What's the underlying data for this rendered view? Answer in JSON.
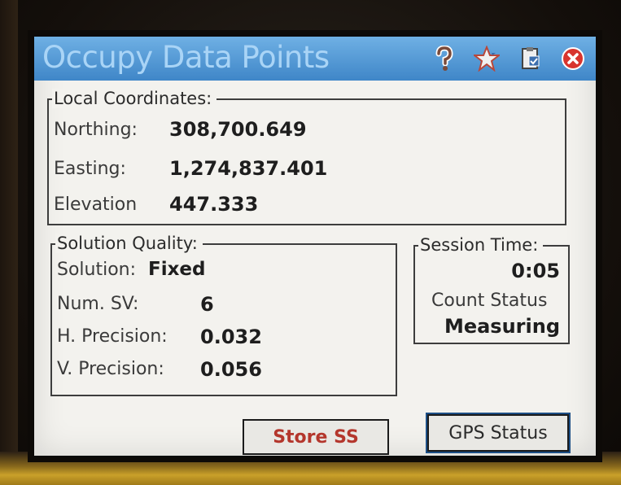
{
  "window": {
    "title": "Occupy Data Points"
  },
  "titlebar_icons": [
    "help-icon",
    "favorites-star-icon",
    "clipboard-icon",
    "close-icon"
  ],
  "local_coordinates": {
    "legend": "Local Coordinates:",
    "northing_label": "Northing:",
    "northing_value": "308,700.649",
    "easting_label": "Easting:",
    "easting_value": "1,274,837.401",
    "elevation_label": "Elevation",
    "elevation_value": "447.333"
  },
  "solution_quality": {
    "legend": "Solution Quality:",
    "solution_label": "Solution:",
    "solution_value": "Fixed",
    "num_sv_label": "Num. SV:",
    "num_sv_value": "6",
    "h_precision_label": "H. Precision:",
    "h_precision_value": "0.032",
    "v_precision_label": "V. Precision:",
    "v_precision_value": "0.056"
  },
  "session_time": {
    "legend": "Session Time:",
    "time_value": "0:05",
    "count_status_label": "Count Status",
    "count_status_value": "Measuring"
  },
  "buttons": {
    "store": "Store SS",
    "gps_status": "GPS Status"
  },
  "colors": {
    "titlebar": "#4a90d0",
    "title_text": "#a9d4f6",
    "store_text": "#b4362c",
    "close_button": "#d8342e"
  }
}
